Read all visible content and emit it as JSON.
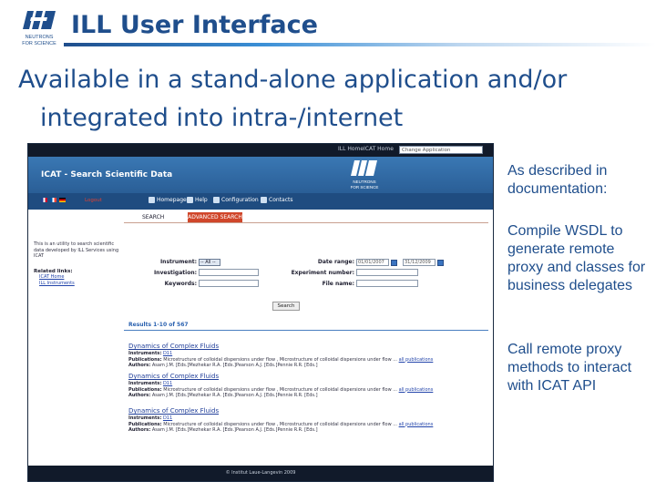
{
  "slide": {
    "title": "ILL User Interface",
    "subtitle_line1": "Available in a stand-alone application and/or",
    "subtitle_line2": "integrated into intra-/internet",
    "logo_text": "NEUTRONS FOR SCIENCE",
    "brand_color": "#1f4e8c"
  },
  "bullets": [
    "As described in documentation:",
    "Compile WSDL to generate remote proxy and classes for business delegates",
    "Call remote proxy methods to interact with ICAT API"
  ],
  "screenshot": {
    "topbar": {
      "items": [
        "ILL Home",
        "ICAT Home"
      ],
      "select_placeholder": "Change Application"
    },
    "header": {
      "title": "ICAT - Search Scientific Data",
      "logo_text": "NEUTRONS FOR SCIENCE"
    },
    "nav": {
      "logout": "Logout",
      "items": [
        "Homepage",
        "Help",
        "Configuration",
        "Contacts"
      ]
    },
    "tabs": {
      "simple": "SEARCH",
      "advanced": "ADVANCED SEARCH"
    },
    "sidebar": {
      "intro": "This is an utility to search scientific data developed by ILL Services using ICAT",
      "related_heading": "Related links:",
      "links": [
        "ICAT Home",
        "ILL Instruments"
      ]
    },
    "form": {
      "instrument_label": "Instrument:",
      "instrument_value": "-- All --",
      "investigation_label": "Investigation:",
      "keywords_label": "Keywords:",
      "date_label": "Date range:",
      "date_from": "01/01/2007",
      "date_to": "31/12/2009",
      "experiment_label": "Experiment number:",
      "file_label": "File name:",
      "search_button": "Search"
    },
    "results_header": "Results 1-10 of 567",
    "results": [
      {
        "title": "Dynamics of Complex Fluids",
        "instruments_label": "Instruments:",
        "instrument": "D11",
        "publications_label": "Publications:",
        "publications": "Microstructure of colloidal dispersions under flow , Microstructure of colloidal dispersions under flow ...",
        "all_publications": "all publications",
        "authors_label": "Authors:",
        "authors": "Asam J.M. [Eds.]Mezhekar R.A. [Eds.]Pearson A.J. [Eds.]Pennie R.R. [Eds.]"
      },
      {
        "title": "Dynamics of Complex Fluids",
        "instruments_label": "Instruments:",
        "instrument": "D11",
        "publications_label": "Publications:",
        "publications": "Microstructure of colloidal dispersions under flow , Microstructure of colloidal dispersions under flow ...",
        "all_publications": "all publications",
        "authors_label": "Authors:",
        "authors": "Asam J.M. [Eds.]Mezhekar R.A. [Eds.]Pearson A.J. [Eds.]Pennie R.R. [Eds.]"
      },
      {
        "title": "Dynamics of Complex Fluids",
        "instruments_label": "Instruments:",
        "instrument": "D11",
        "publications_label": "Publications:",
        "publications": "Microstructure of colloidal dispersions under flow , Microstructure of colloidal dispersions under flow ...",
        "all_publications": "all publications",
        "authors_label": "Authors:",
        "authors": "Asam J.M. [Eds.]Mezhekar R.A. [Eds.]Pearson A.J. [Eds.]Pennie R.R. [Eds.]"
      }
    ],
    "footer": "© Institut Laue-Langevin 2009"
  }
}
